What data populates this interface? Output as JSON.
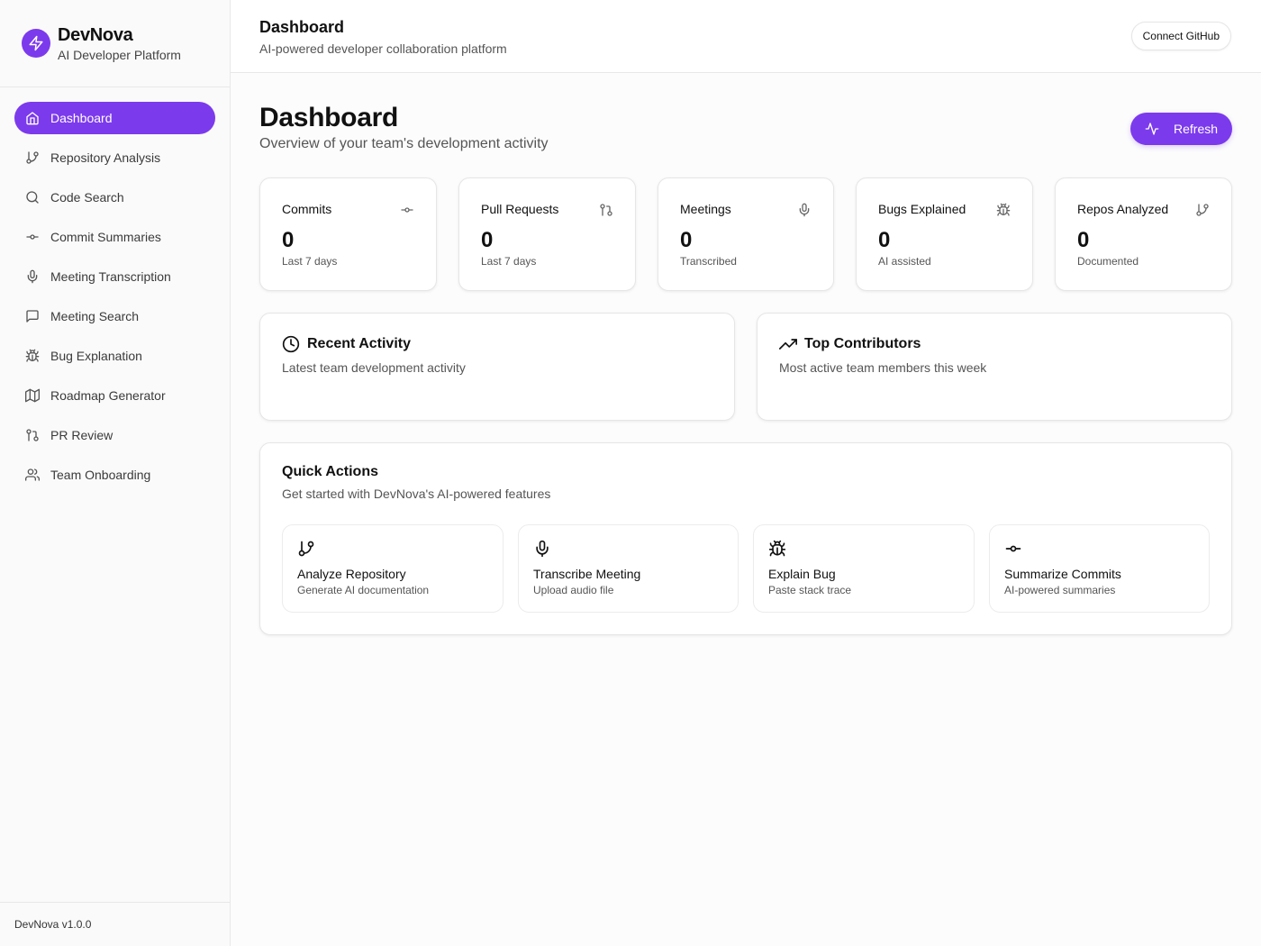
{
  "brand": {
    "name": "DevNova",
    "subtitle": "AI Developer Platform",
    "accent": "#7c3aed"
  },
  "sidebar": {
    "items": [
      {
        "label": "Dashboard",
        "icon": "home-icon",
        "active": true
      },
      {
        "label": "Repository Analysis",
        "icon": "git-branch-icon"
      },
      {
        "label": "Code Search",
        "icon": "search-icon"
      },
      {
        "label": "Commit Summaries",
        "icon": "git-commit-icon"
      },
      {
        "label": "Meeting Transcription",
        "icon": "mic-icon"
      },
      {
        "label": "Meeting Search",
        "icon": "message-square-icon"
      },
      {
        "label": "Bug Explanation",
        "icon": "bug-icon"
      },
      {
        "label": "Roadmap Generator",
        "icon": "map-icon"
      },
      {
        "label": "PR Review",
        "icon": "git-pull-request-icon"
      },
      {
        "label": "Team Onboarding",
        "icon": "users-icon"
      }
    ],
    "footer": "DevNova v1.0.0"
  },
  "header": {
    "title": "Dashboard",
    "subtitle": "AI-powered developer collaboration platform",
    "connect_label": "Connect GitHub"
  },
  "main": {
    "title": "Dashboard",
    "subtitle": "Overview of your team's development activity",
    "refresh_label": "Refresh",
    "stats": [
      {
        "label": "Commits",
        "value": "0",
        "note": "Last 7 days",
        "icon": "git-commit-icon"
      },
      {
        "label": "Pull Requests",
        "value": "0",
        "note": "Last 7 days",
        "icon": "git-pull-request-icon"
      },
      {
        "label": "Meetings",
        "value": "0",
        "note": "Transcribed",
        "icon": "mic-icon"
      },
      {
        "label": "Bugs Explained",
        "value": "0",
        "note": "AI assisted",
        "icon": "bug-icon"
      },
      {
        "label": "Repos Analyzed",
        "value": "0",
        "note": "Documented",
        "icon": "git-branch-icon"
      }
    ],
    "recent_activity": {
      "title": "Recent Activity",
      "subtitle": "Latest team development activity",
      "icon": "clock-icon"
    },
    "top_contributors": {
      "title": "Top Contributors",
      "subtitle": "Most active team members this week",
      "icon": "trending-up-icon"
    },
    "quick_actions": {
      "title": "Quick Actions",
      "subtitle": "Get started with DevNova's AI-powered features",
      "items": [
        {
          "label": "Analyze Repository",
          "desc": "Generate AI documentation",
          "icon": "git-branch-icon"
        },
        {
          "label": "Transcribe Meeting",
          "desc": "Upload audio file",
          "icon": "mic-icon"
        },
        {
          "label": "Explain Bug",
          "desc": "Paste stack trace",
          "icon": "bug-icon"
        },
        {
          "label": "Summarize Commits",
          "desc": "AI-powered summaries",
          "icon": "git-commit-icon"
        }
      ]
    }
  }
}
